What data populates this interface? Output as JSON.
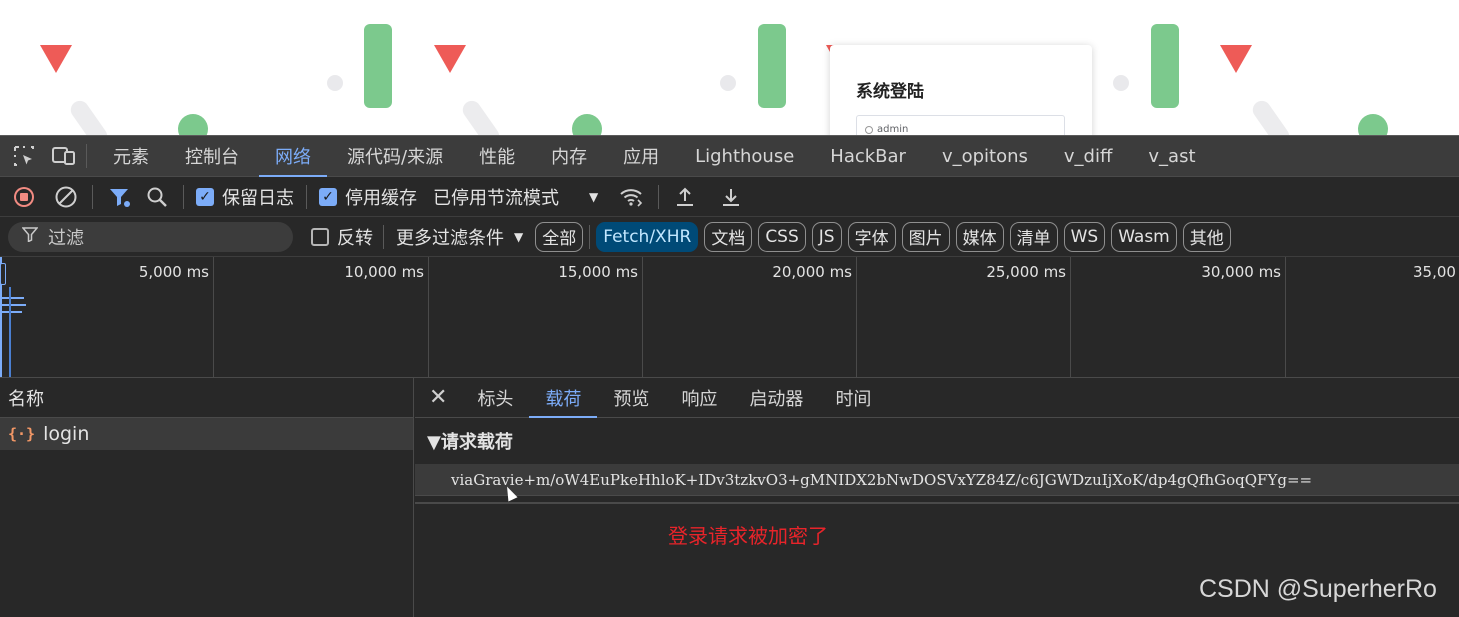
{
  "page_preview": {
    "login_title": "系统登陆",
    "username_value": "admin"
  },
  "devtools": {
    "main_tabs": [
      "元素",
      "控制台",
      "网络",
      "源代码/来源",
      "性能",
      "内存",
      "应用",
      "Lighthouse",
      "HackBar",
      "v_opitons",
      "v_diff",
      "v_ast"
    ],
    "active_tab": "网络",
    "toolbar": {
      "preserve_log_label": "保留日志",
      "preserve_log_checked": true,
      "disable_cache_label": "停用缓存",
      "disable_cache_checked": true,
      "throttling_value": "已停用节流模式"
    },
    "filter_bar": {
      "filter_placeholder": "过滤",
      "invert_label": "反转",
      "invert_checked": false,
      "more_filters_label": "更多过滤条件",
      "type_chips": [
        "全部",
        "Fetch/XHR",
        "文档",
        "CSS",
        "JS",
        "字体",
        "图片",
        "媒体",
        "清单",
        "WS",
        "Wasm",
        "其他"
      ],
      "active_chip": "Fetch/XHR"
    },
    "timeline_ticks": [
      "5,000 ms",
      "10,000 ms",
      "15,000 ms",
      "20,000 ms",
      "25,000 ms",
      "30,000 ms",
      "35,00"
    ],
    "request_list": {
      "header": "名称",
      "rows": [
        {
          "name": "login",
          "type_icon": "xhr-braces-icon"
        }
      ]
    },
    "details": {
      "tabs": [
        "标头",
        "载荷",
        "预览",
        "响应",
        "启动器",
        "时间"
      ],
      "active_tab": "载荷",
      "section_title": "▼请求载荷",
      "payload_text": "viaGravie+m/oW4EuPkeHhloK+IDv3tzkvO3+gMNIDX2bNwDOSVxYZ84Z/c6JGWDzuIjXoK/dp4gQfhGoqQFYg=="
    },
    "annotation": "登录请求被加密了"
  },
  "watermark": "CSDN @SuperherRo",
  "colors": {
    "accent": "#7cacf8",
    "annotation": "#e8242a",
    "record_stop": "#f28b82",
    "xhr_icon": "#f29766"
  }
}
